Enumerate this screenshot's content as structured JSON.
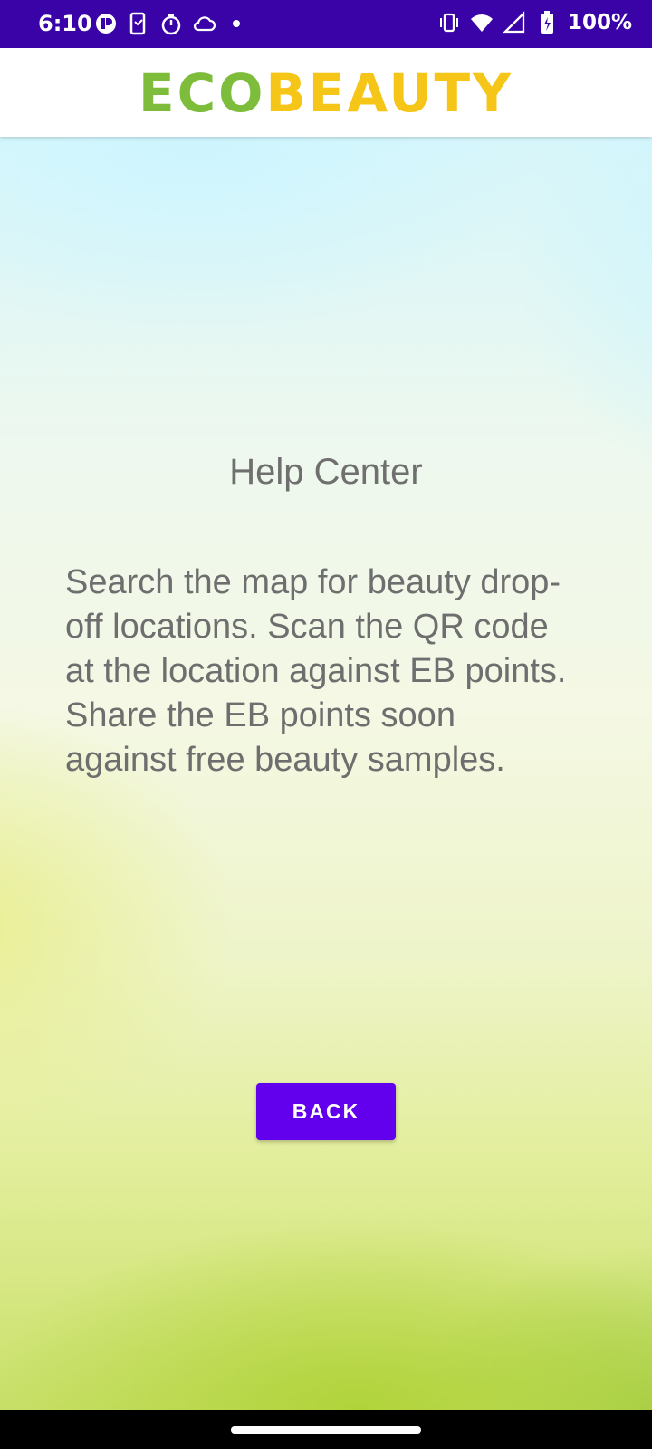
{
  "status_bar": {
    "time": "6:10",
    "battery_percent": "100%",
    "icons_left": [
      "notification-app-icon",
      "device-transfer-icon",
      "timer-icon",
      "cloud-icon",
      "more-dot-icon"
    ],
    "icons_right": [
      "vibrate-icon",
      "wifi-icon",
      "cell-signal-icon",
      "battery-charging-icon"
    ]
  },
  "app_bar": {
    "logo_part1": "ECO",
    "logo_part2": "BEAUTY",
    "logo_color1": "#7ebd3c",
    "logo_color2": "#f5c518"
  },
  "main": {
    "title": "Help Center",
    "body": "Search the map for beauty drop-off locations. Scan the QR code at the location against EB points. Share the EB points soon against free beauty samples.",
    "back_label": "BACK",
    "accent_color": "#6200ee"
  }
}
